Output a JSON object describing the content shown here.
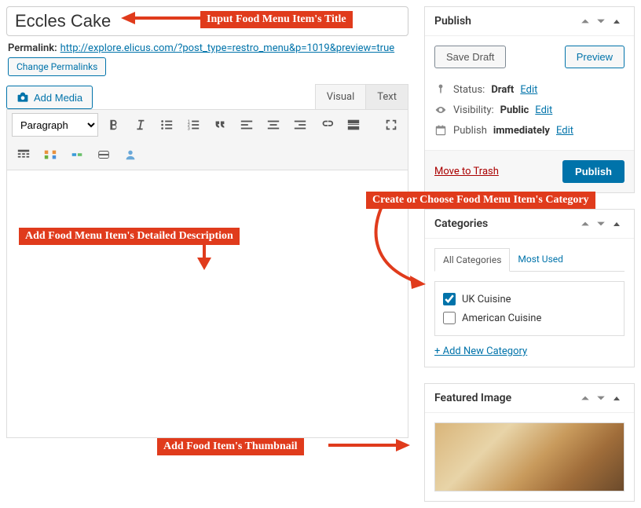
{
  "title_value": "Eccles Cake",
  "permalink": {
    "label": "Permalink:",
    "url": "http://explore.elicus.com/?post_type=restro_menu&p=1019&preview=true",
    "change_btn": "Change Permalinks"
  },
  "add_media_btn": "Add Media",
  "tabs": {
    "visual": "Visual",
    "text": "Text"
  },
  "format_select": "Paragraph",
  "publish_panel": {
    "title": "Publish",
    "save_draft": "Save Draft",
    "preview": "Preview",
    "status_label": "Status:",
    "status_value": "Draft",
    "visibility_label": "Visibility:",
    "visibility_value": "Public",
    "schedule_label": "Publish",
    "schedule_value": "immediately",
    "edit": "Edit",
    "trash": "Move to Trash",
    "publish_btn": "Publish"
  },
  "categories_panel": {
    "title": "Categories",
    "tab_all": "All Categories",
    "tab_used": "Most Used",
    "items": [
      {
        "label": "UK Cuisine",
        "checked": true
      },
      {
        "label": "American Cuisine",
        "checked": false
      }
    ],
    "add_new": "+ Add New Category"
  },
  "featured_panel": {
    "title": "Featured Image"
  },
  "annotations": {
    "title": "Input Food Menu Item's Title",
    "description": "Add Food Menu Item's Detailed Description",
    "category": "Create or Choose Food Menu Item's Category",
    "thumbnail": "Add Food Item's Thumbnail"
  }
}
